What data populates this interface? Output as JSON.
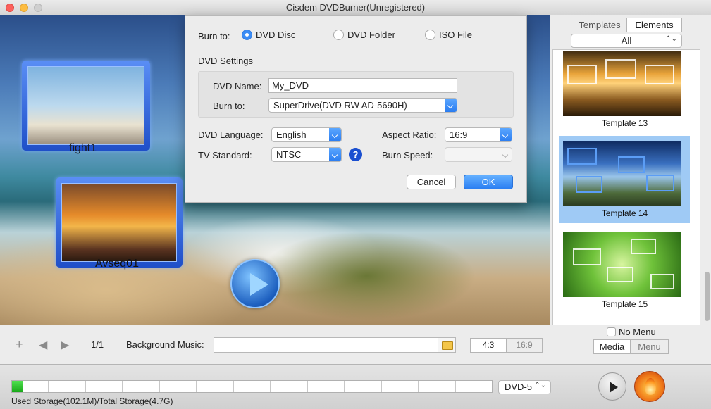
{
  "window": {
    "title": "Cisdem DVDBurner(Unregistered)"
  },
  "preview": {
    "thumbnails": [
      {
        "label": "fight1"
      },
      {
        "label": "Avseq01"
      }
    ]
  },
  "dialog": {
    "burn_to_label": "Burn to:",
    "burn_targets": [
      {
        "label": "DVD Disc",
        "selected": true
      },
      {
        "label": "DVD Folder",
        "selected": false
      },
      {
        "label": "ISO File",
        "selected": false
      }
    ],
    "dvd_settings_title": "DVD Settings",
    "dvd_name_label": "DVD Name:",
    "dvd_name_value": "My_DVD",
    "burner_label": "Burn to:",
    "burner_value": "SuperDrive(DVD RW AD-5690H)",
    "language_label": "DVD Language:",
    "language_value": "English",
    "tv_standard_label": "TV Standard:",
    "tv_standard_value": "NTSC",
    "help_glyph": "?",
    "aspect_label": "Aspect Ratio:",
    "aspect_value": "16:9",
    "speed_label": "Burn Speed:",
    "speed_value": "",
    "cancel_label": "Cancel",
    "ok_label": "OK"
  },
  "right_panel": {
    "tabs": [
      {
        "label": "Templates",
        "active": false
      },
      {
        "label": "Elements",
        "active": true
      }
    ],
    "filter_value": "All",
    "templates": [
      {
        "name": "Template 13",
        "selected": false
      },
      {
        "name": "Template 14",
        "selected": true
      },
      {
        "name": "Template 15",
        "selected": false
      }
    ],
    "no_menu_label": "No Menu",
    "no_menu_checked": false,
    "mode_tabs": [
      {
        "label": "Media",
        "active": true
      },
      {
        "label": "Menu",
        "active": false
      }
    ]
  },
  "toolbar": {
    "add_icon": "plus-icon",
    "prev_icon": "arrow-left-icon",
    "next_icon": "arrow-right-icon",
    "page_indicator": "1/1",
    "background_music_label": "Background Music:",
    "background_music_value": "",
    "ratio_options": [
      {
        "label": "4:3",
        "active": true
      },
      {
        "label": "16:9",
        "active": false
      }
    ]
  },
  "statusbar": {
    "disc_type": "DVD-5",
    "storage_text": "Used Storage(102.1M)/Total Storage(4.7G)",
    "storage_used_fraction": 0.022
  },
  "colors": {
    "accent": "#2a7ef2",
    "storage_fill": "#1aa81a",
    "selection": "#9fcaf5"
  }
}
